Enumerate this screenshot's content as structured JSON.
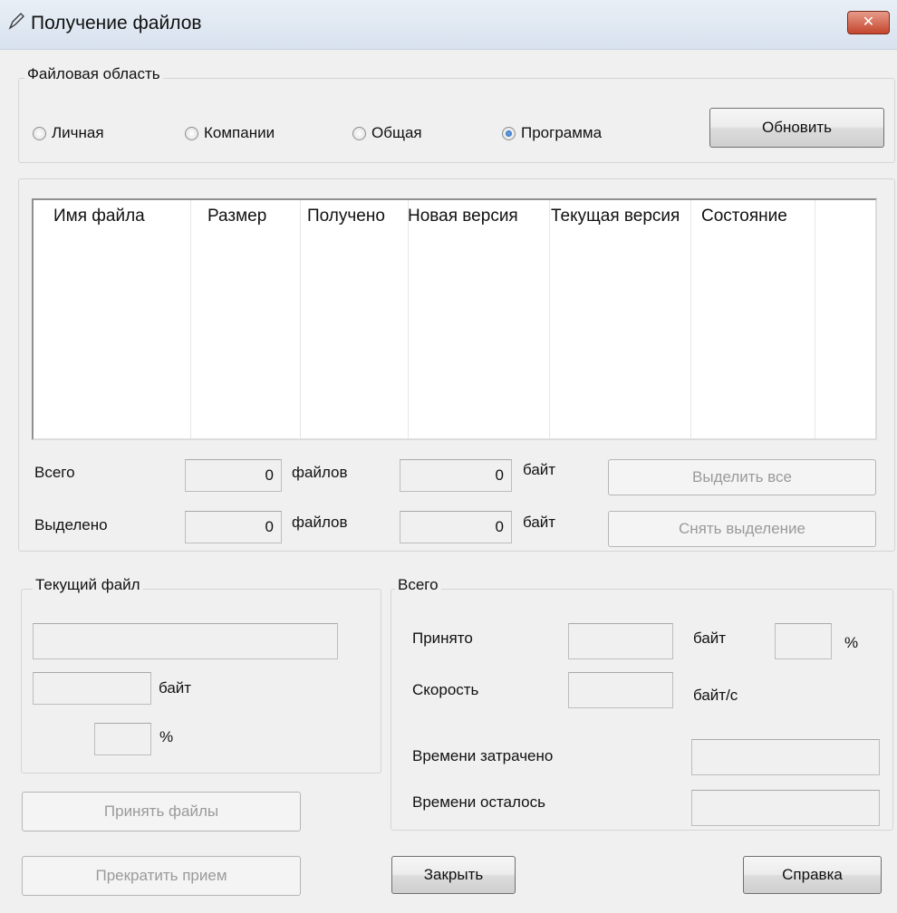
{
  "window": {
    "title": "Получение файлов",
    "close": "✕"
  },
  "area": {
    "label": "Файловая область",
    "radios": [
      {
        "label": "Личная",
        "checked": false
      },
      {
        "label": "Компании",
        "checked": false
      },
      {
        "label": "Общая",
        "checked": false
      },
      {
        "label": "Программа",
        "checked": true
      }
    ],
    "refresh_label": "Обновить"
  },
  "files": {
    "columns": [
      "Имя файла",
      "Размер",
      "Получено",
      "Новая версия",
      "Текущая версия",
      "Состояние"
    ],
    "rows": [],
    "total_label": "Всего",
    "selected_label": "Выделено",
    "total_files": "0",
    "total_bytes": "0",
    "selected_files": "0",
    "selected_bytes": "0",
    "files_unit": "файлов",
    "bytes_unit": "байт",
    "select_all": "Выделить все",
    "deselect": "Снять выделение"
  },
  "current": {
    "label": "Текущий файл",
    "name": "",
    "bytes": "",
    "bytes_unit": "байт",
    "percent": "",
    "percent_unit": "%"
  },
  "total": {
    "label": "Всего",
    "received_label": "Принято",
    "received": "",
    "received_unit": "байт",
    "received_percent": "",
    "percent_unit": "%",
    "speed_label": "Скорость",
    "speed": "",
    "speed_unit": "байт/с",
    "elapsed_label": "Времени затрачено",
    "elapsed": "",
    "remaining_label": "Времени осталось",
    "remaining": ""
  },
  "buttons": {
    "accept": "Принять файлы",
    "stop": "Прекратить прием",
    "close": "Закрыть",
    "help": "Справка"
  }
}
